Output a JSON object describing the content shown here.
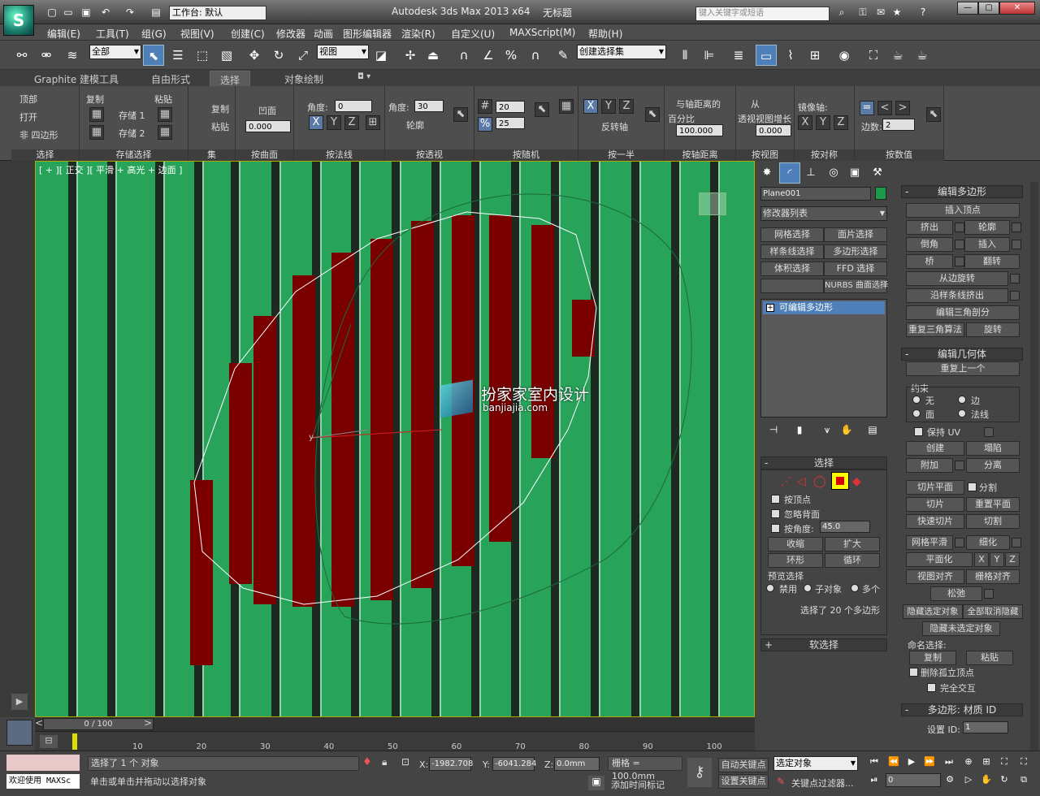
{
  "titlebar": {
    "workspace_label": "工作台: 默认",
    "app_title": "Autodesk 3ds Max  2013 x64",
    "doc_title": "无标题",
    "search_placeholder": "键入关键字或短语"
  },
  "menu": [
    "编辑(E)",
    "工具(T)",
    "组(G)",
    "视图(V)",
    "创建(C)",
    "修改器",
    "动画",
    "图形编辑器",
    "渲染(R)",
    "自定义(U)",
    "MAXScript(M)",
    "帮助(H)"
  ],
  "toolbar": {
    "filter_value": "全部",
    "refcoord_value": "视图",
    "named_selection_value": "创建选择集"
  },
  "ribbon_tabs": [
    "Graphite 建模工具",
    "自由形式",
    "选择",
    "对象绘制"
  ],
  "ribbon": {
    "select": {
      "top": "顶部",
      "open": "打开",
      "nonquad": "非 四边形",
      "footer": "选择"
    },
    "store": {
      "copy": "复制",
      "paste": "粘贴",
      "store1": "存储 1",
      "store2": "存储 2",
      "footer": "存储选择"
    },
    "set": {
      "copy": "复制",
      "paste": "粘贴",
      "footer": "集"
    },
    "bycurve": {
      "concave": "凹面",
      "value": "0.000",
      "footer": "按曲面"
    },
    "bynormal": {
      "angle_label": "角度:",
      "angle": "0",
      "footer": "按法线"
    },
    "byview": {
      "angle_label": "角度:",
      "angle": "30",
      "outline": "轮廓",
      "footer": "按透视"
    },
    "random": {
      "v1": "20",
      "v2": "25",
      "footer": "按随机"
    },
    "half": {
      "invert": "反转轴",
      "footer": "按一半"
    },
    "pivotdist": {
      "l1": "与轴距离的",
      "l2": "百分比",
      "value": "100.000",
      "footer": "按轴距离"
    },
    "view": {
      "l1": "从",
      "l2": "透视视图增长",
      "value": "0.000",
      "footer": "按视图"
    },
    "symmetry": {
      "mirror_label": "镜像轴:",
      "footer": "按对称"
    },
    "numeric": {
      "sides_label": "边数:",
      "sides": "2",
      "footer": "按数值"
    }
  },
  "viewport": {
    "label": "[ + ][ 正交 ][ 平滑 + 高光 + 边面 ]",
    "watermark_cn": "扮家家室内设计",
    "watermark_en": "banjiajia.com"
  },
  "command_panel": {
    "object_name": "Plane001",
    "object_color": "#1a9a4a",
    "modifier_list": "修改器列表",
    "buttons": [
      "网格选择",
      "面片选择",
      "样条线选择",
      "多边形选择",
      "体积选择",
      "FFD 选择",
      "",
      "NURBS 曲面选择"
    ],
    "stack_item": "可编辑多边形",
    "selection_title": "选择",
    "by_vertex": "按顶点",
    "ignore_backface": "忽略背面",
    "by_angle": "按角度:",
    "angle_value": "45.0",
    "shrink": "收缩",
    "grow": "扩大",
    "ring": "环形",
    "loop": "循环",
    "preview_title": "预览选择",
    "preview_opts": [
      "禁用",
      "子对象",
      "多个"
    ],
    "status": "选择了 20 个多边形",
    "soft_title": "软选择"
  },
  "edit_poly": {
    "title": "编辑多边形",
    "insert_vertex": "插入顶点",
    "pairs": [
      [
        "挤出",
        "轮廓"
      ],
      [
        "倒角",
        "插入"
      ],
      [
        "桥",
        "翻转"
      ]
    ],
    "hinge": "从边旋转",
    "extrude_spline": "沿样条线挤出",
    "edit_tri": "编辑三角剖分",
    "retriangulate": "重复三角算法",
    "turn": "旋转",
    "geom_title": "编辑几何体",
    "repeat_last": "重复上一个",
    "constraints_title": "约束",
    "constraints": [
      "无",
      "边",
      "面",
      "法线"
    ],
    "preserve_uv": "保持 UV",
    "create": "创建",
    "collapse": "塌陷",
    "attach": "附加",
    "detach": "分离",
    "slice_plane": "切片平面",
    "split": "分割",
    "slice": "切片",
    "reset_plane": "重置平面",
    "quickslice": "快速切片",
    "cut": "切割",
    "meshsmooth": "网格平滑",
    "tessellate": "细化",
    "make_planar": "平面化",
    "axes": [
      "X",
      "Y",
      "Z"
    ],
    "view_align": "视图对齐",
    "grid_align": "栅格对齐",
    "relax": "松弛",
    "hide_sel": "隐藏选定对象",
    "unhide_all": "全部取消隐藏",
    "hide_unsel": "隐藏未选定对象",
    "named_sel": "命名选择:",
    "copy": "复制",
    "paste": "粘贴",
    "delete_iso": "删除孤立顶点",
    "full_interact": "完全交互",
    "matid_title": "多边形: 材质 ID",
    "set_id": "设置 ID:",
    "set_id_value": "1"
  },
  "timeline": {
    "frame": "0 / 100",
    "ticks": [
      "10",
      "20",
      "30",
      "40",
      "50",
      "60",
      "70",
      "80",
      "90",
      "100"
    ]
  },
  "status": {
    "welcome": "欢迎使用 MAXSc",
    "selected": "选择了 1 个 对象",
    "prompt": "单击或单击并拖动以选择对象",
    "x_label": "X:",
    "x": "-1982.708",
    "y_label": "Y:",
    "y": "-6041.284",
    "z_label": "Z:",
    "z": "0.0mm",
    "grid": "栅格 = 100.0mm",
    "autokey": "自动关键点",
    "setkey": "设置关键点",
    "sel_obj": "选定对象",
    "key_filter": "关键点过滤器...",
    "add_time_tag": "添加时间标记",
    "frame_value": "0"
  }
}
